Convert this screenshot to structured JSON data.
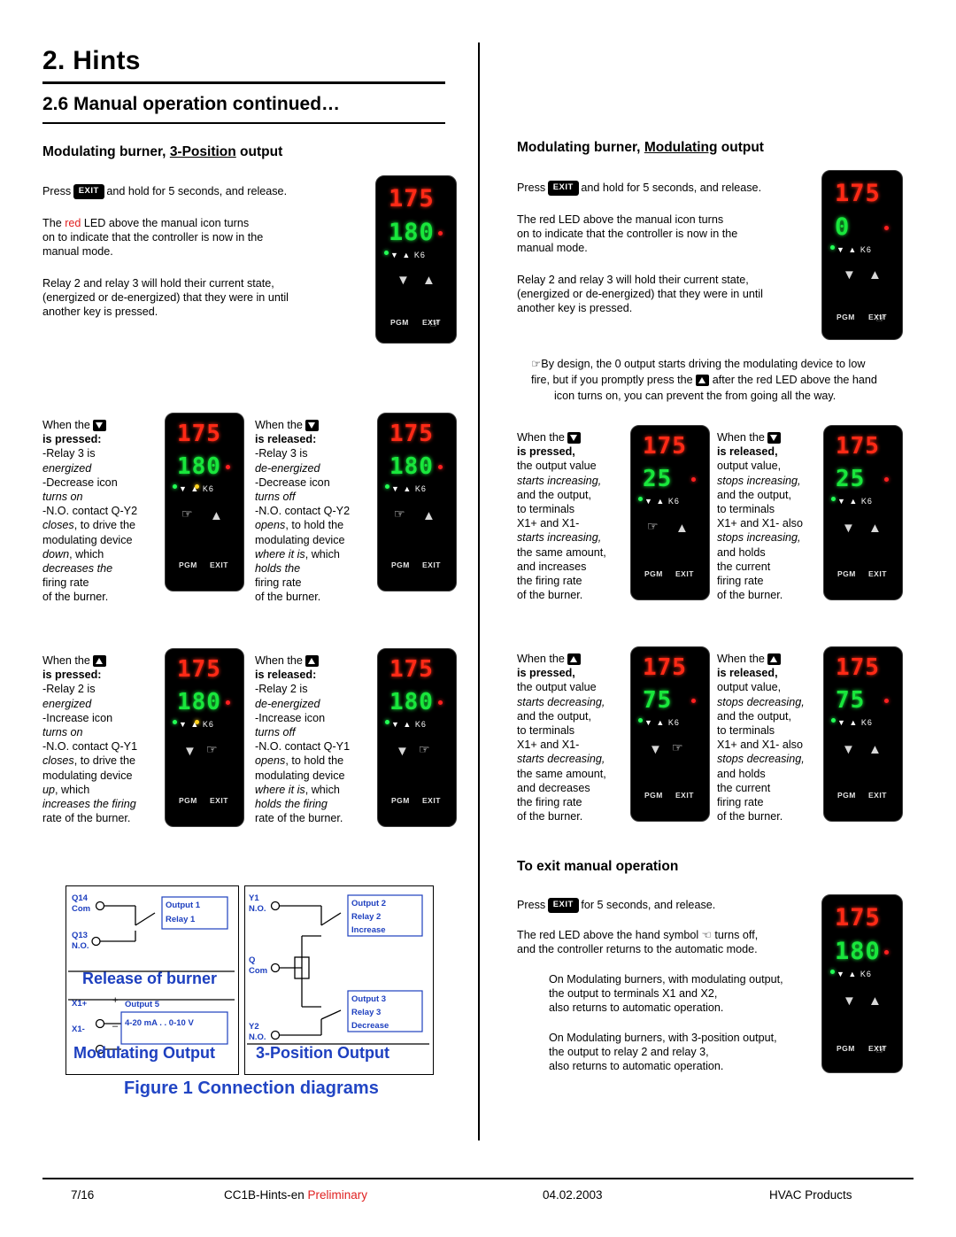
{
  "header": {
    "chapter": "2. Hints",
    "section": "2.6 Manual operation continued…"
  },
  "left": {
    "heading_pre": "Modulating burner, ",
    "heading_u": "3-Position",
    "heading_post": " output",
    "p1_pre": "Press ",
    "p1_key": "EXIT",
    "p1_post": " and hold for 5 seconds, and release.",
    "p2_a": "The ",
    "p2_red": "red",
    "p2_b": " LED above the manual icon turns",
    "p2_c": "on to indicate that the controller is now in the",
    "p2_d": "manual mode.",
    "p3_a": "Relay 2 and relay 3 will hold their current state,",
    "p3_b": "(energized or de-energized) that they were in until",
    "p3_c": "another key is pressed."
  },
  "right": {
    "heading_pre": "Modulating burner, ",
    "heading_u": "Modulating",
    "heading_post": " output",
    "p1_pre": "Press ",
    "p1_key": "EXIT",
    "p1_post": " and hold for 5 seconds, and release.",
    "p2_a": "The red LED above the manual icon turns",
    "p2_b": "on to indicate that the controller is now in the",
    "p2_c": "manual mode.",
    "p3_a": "Relay 2 and relay 3 will hold their current state,",
    "p3_b": "(energized or de-energized) that they were in until",
    "p3_c": "another key is pressed.",
    "note_a": "By design, the 0 output starts driving the modulating device to low",
    "note_b": "fire, but if you promptly press the",
    "note_b2": "after the red LED above the hand",
    "note_c": "icon turns on, you can prevent the from going all the way."
  },
  "blocks": {
    "l_dn_pressed": {
      "when": "When the",
      "state": "is pressed:",
      "lines": [
        {
          "t": "-Relay 3 is",
          "i": false
        },
        {
          "t": "energized",
          "i": true
        },
        {
          "t": "-Decrease icon",
          "i": false
        },
        {
          "t": "turns on",
          "i": true
        },
        {
          "t": "-N.O. contact Q-Y2",
          "i": false
        },
        {
          "t": "closes, to drive the",
          "i": "mix-closes"
        },
        {
          "t": "modulating device",
          "i": false
        },
        {
          "t": "down, which",
          "i": "mix-down"
        },
        {
          "t": "decreases the",
          "i": true
        },
        {
          "t": "firing rate",
          "i": false
        },
        {
          "t": "of the burner.",
          "i": false
        }
      ]
    },
    "l_dn_released": {
      "when": "When the",
      "state": "is released:",
      "lines": [
        {
          "t": "-Relay 3 is",
          "i": false
        },
        {
          "t": "de-energized",
          "i": true
        },
        {
          "t": "-Decrease icon",
          "i": false
        },
        {
          "t": "turns off",
          "i": true
        },
        {
          "t": "-N.O. contact Q-Y2",
          "i": false
        },
        {
          "t": "opens, to hold the",
          "i": "mix-opens"
        },
        {
          "t": "modulating device",
          "i": false
        },
        {
          "t": "where it is, which",
          "i": "mix-where"
        },
        {
          "t": "holds the",
          "i": true
        },
        {
          "t": "firing rate",
          "i": false
        },
        {
          "t": "of the burner.",
          "i": false
        }
      ]
    },
    "l_up_pressed": {
      "when": "When the",
      "state": "is pressed:",
      "lines": [
        {
          "t": "-Relay 2 is",
          "i": false
        },
        {
          "t": "energized",
          "i": true
        },
        {
          "t": "-Increase icon",
          "i": false
        },
        {
          "t": "turns on",
          "i": true
        },
        {
          "t": "-N.O. contact Q-Y1",
          "i": false
        },
        {
          "t": "closes, to drive the",
          "i": "mix-closes"
        },
        {
          "t": "modulating device",
          "i": false
        },
        {
          "t": "up, which",
          "i": "mix-up"
        },
        {
          "t": "increases the firing",
          "i": true
        },
        {
          "t": "rate of the burner.",
          "i": false
        }
      ]
    },
    "l_up_released": {
      "when": "When the",
      "state": "is released:",
      "lines": [
        {
          "t": "-Relay 2 is",
          "i": false
        },
        {
          "t": "de-energized",
          "i": true
        },
        {
          "t": "-Increase icon",
          "i": false
        },
        {
          "t": "turns off",
          "i": true
        },
        {
          "t": "-N.O. contact Q-Y1",
          "i": false
        },
        {
          "t": "opens, to hold the",
          "i": "mix-opens"
        },
        {
          "t": "modulating device",
          "i": false
        },
        {
          "t": "where it is, which",
          "i": "mix-where"
        },
        {
          "t": "holds the firing",
          "i": true
        },
        {
          "t": "rate of the burner.",
          "i": false
        }
      ]
    },
    "r_dn_pressed": {
      "when": "When the",
      "state": "is pressed,",
      "lines": [
        {
          "t": "the output value",
          "i": false
        },
        {
          "t": "starts increasing,",
          "i": true
        },
        {
          "t": "and the output,",
          "i": false
        },
        {
          "t": "to terminals",
          "i": false
        },
        {
          "t": "X1+ and X1-",
          "i": false
        },
        {
          "t": "starts increasing,",
          "i": true
        },
        {
          "t": "the same amount,",
          "i": false
        },
        {
          "t": "and increases",
          "i": false
        },
        {
          "t": "the firing rate",
          "i": false
        },
        {
          "t": "of the burner.",
          "i": false
        }
      ]
    },
    "r_dn_released": {
      "when": "When the",
      "state": "is released,",
      "lines": [
        {
          "t": "output value,",
          "i": false
        },
        {
          "t": "stops increasing,",
          "i": true
        },
        {
          "t": "and the output,",
          "i": false
        },
        {
          "t": "to terminals",
          "i": false
        },
        {
          "t": "X1+ and X1- also",
          "i": false
        },
        {
          "t": "stops increasing,",
          "i": true
        },
        {
          "t": "and holds",
          "i": false
        },
        {
          "t": "the current",
          "i": false
        },
        {
          "t": "firing rate",
          "i": false
        },
        {
          "t": "of the burner.",
          "i": false
        }
      ]
    },
    "r_up_pressed": {
      "when": "When the",
      "state": "is pressed,",
      "lines": [
        {
          "t": "the output value",
          "i": false
        },
        {
          "t": "starts decreasing,",
          "i": true
        },
        {
          "t": "and the output,",
          "i": false
        },
        {
          "t": "to terminals",
          "i": false
        },
        {
          "t": "X1+ and X1-",
          "i": false
        },
        {
          "t": "starts decreasing,",
          "i": true
        },
        {
          "t": "the same amount,",
          "i": false
        },
        {
          "t": "and decreases",
          "i": false
        },
        {
          "t": "the firing rate",
          "i": false
        },
        {
          "t": "of the burner.",
          "i": false
        }
      ]
    },
    "r_up_released": {
      "when": "When the",
      "state": "is released,",
      "lines": [
        {
          "t": "output value,",
          "i": false
        },
        {
          "t": "stops decreasing,",
          "i": true
        },
        {
          "t": "and the output,",
          "i": false
        },
        {
          "t": "to terminals",
          "i": false
        },
        {
          "t": "X1+ and X1- also",
          "i": false
        },
        {
          "t": "stops decreasing,",
          "i": true
        },
        {
          "t": "and holds",
          "i": false
        },
        {
          "t": "the current",
          "i": false
        },
        {
          "t": "firing rate",
          "i": false
        },
        {
          "t": "of the burner.",
          "i": false
        }
      ]
    }
  },
  "exit_section": {
    "heading": "To exit manual operation",
    "p1_pre": "Press ",
    "p1_key": "EXIT",
    "p1_post": " for 5 seconds, and release.",
    "p2_a": "The red LED above the hand symbol",
    "p2_a2": "turns off,",
    "p2_b": "and the controller returns to the automatic mode.",
    "p3_a": "On Modulating burners, with modulating output,",
    "p3_b": "the output to terminals X1 and X2,",
    "p3_c": "also returns to automatic operation.",
    "p4_a": "On Modulating burners, with 3-position output,",
    "p4_b": "the output to relay 2 and relay 3,",
    "p4_c": "also returns to  automatic operation."
  },
  "displays": {
    "d1": {
      "top": "175",
      "bottom": "180",
      "bottom_color": "#19e63c"
    },
    "d2": {
      "top": "175",
      "bottom": "180",
      "bottom_color": "#19e63c"
    },
    "d3": {
      "top": "175",
      "bottom": "180",
      "bottom_color": "#19e63c"
    },
    "d4": {
      "top": "175",
      "bottom": "180",
      "bottom_color": "#19e63c"
    },
    "d5": {
      "top": "175",
      "bottom": "180",
      "bottom_color": "#19e63c"
    },
    "r1": {
      "top": "175",
      "bottom": "0",
      "bottom_color": "#19e63c"
    },
    "r2": {
      "top": "175",
      "bottom": "25",
      "bottom_color": "#19e63c"
    },
    "r3": {
      "top": "175",
      "bottom": "25",
      "bottom_color": "#19e63c"
    },
    "r4": {
      "top": "175",
      "bottom": "75",
      "bottom_color": "#19e63c"
    },
    "r5": {
      "top": "175",
      "bottom": "75",
      "bottom_color": "#19e63c"
    },
    "r6": {
      "top": "175",
      "bottom": "180",
      "bottom_color": "#19e63c"
    },
    "iconrow": "▼ ▲  K6",
    "pgm": "PGM",
    "exit": "EXIT"
  },
  "figure": {
    "caption": "Figure 1 Connection diagrams",
    "mod": {
      "q14": "Q14",
      "com1": "Com",
      "q13": "Q13",
      "no1": "N.O.",
      "out1": "Output 1",
      "relay1": "Relay 1",
      "release_title": "Release of burner",
      "x1p": "X1+",
      "x1m": "X1-",
      "plus": "+",
      "minus": "–",
      "out5": "Output 5",
      "range": "4-20 mA . .  0-10 V",
      "mod_title": "Modulating Output"
    },
    "pos3": {
      "y1": "Y1",
      "no1": "N.O.",
      "q": "Q",
      "com": "Com",
      "y2": "Y2",
      "no2": "N.O.",
      "out2": "Output 2",
      "relay2": "Relay 2",
      "increase": "Increase",
      "out3": "Output 3",
      "relay3": "Relay 3",
      "decrease": "Decrease",
      "title": "3-Position  Output"
    }
  },
  "footer": {
    "page": "7/16",
    "doc": "CC1B-Hints-en ",
    "doc_red": "Preliminary",
    "date": "04.02.2003",
    "right": "HVAC Products"
  }
}
